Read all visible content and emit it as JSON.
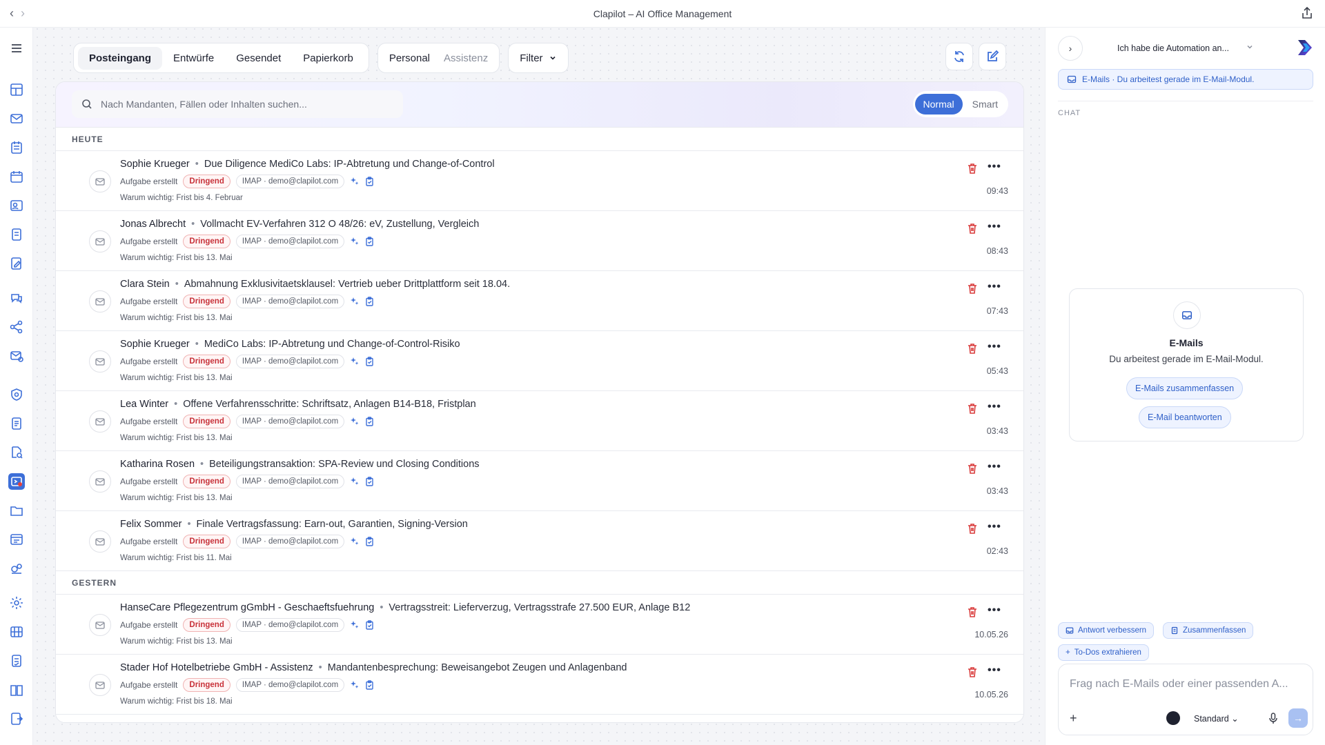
{
  "window": {
    "title": "Clapilot – AI Office Management"
  },
  "toolbar": {
    "tabs": [
      "Posteingang",
      "Entwürfe",
      "Gesendet",
      "Papierkorb"
    ],
    "scope": [
      "Personal",
      "Assistenz"
    ],
    "filter_label": "Filter"
  },
  "search": {
    "placeholder": "Nach Mandanten, Fällen oder Inhalten suchen...",
    "modes": [
      "Normal",
      "Smart"
    ]
  },
  "sections": {
    "today": "HEUTE",
    "yesterday": "GESTERN"
  },
  "labels": {
    "status": "Aufgabe erstellt",
    "urgent": "Dringend",
    "account": "IMAP · demo@clapilot.com"
  },
  "emails": [
    {
      "sender": "Sophie Krueger",
      "subject": "Due Diligence MediCo Labs: IP-Abtretung und Change-of-Control",
      "reason": "Warum wichtig: Frist bis 4. Februar",
      "time": "09:43"
    },
    {
      "sender": "Jonas Albrecht",
      "subject": "Vollmacht EV-Verfahren 312 O 48/26: eV, Zustellung, Vergleich",
      "reason": "Warum wichtig: Frist bis 13. Mai",
      "time": "08:43"
    },
    {
      "sender": "Clara Stein",
      "subject": "Abmahnung Exklusivitaetsklausel: Vertrieb ueber Drittplattform seit 18.04.",
      "reason": "Warum wichtig: Frist bis 13. Mai",
      "time": "07:43"
    },
    {
      "sender": "Sophie Krueger",
      "subject": "MediCo Labs: IP-Abtretung und Change-of-Control-Risiko",
      "reason": "Warum wichtig: Frist bis 13. Mai",
      "time": "05:43"
    },
    {
      "sender": "Lea Winter",
      "subject": "Offene Verfahrensschritte: Schriftsatz, Anlagen B14-B18, Fristplan",
      "reason": "Warum wichtig: Frist bis 13. Mai",
      "time": "03:43"
    },
    {
      "sender": "Katharina Rosen",
      "subject": "Beteiligungstransaktion: SPA-Review und Closing Conditions",
      "reason": "Warum wichtig: Frist bis 13. Mai",
      "time": "03:43"
    },
    {
      "sender": "Felix Sommer",
      "subject": "Finale Vertragsfassung: Earn-out, Garantien, Signing-Version",
      "reason": "Warum wichtig: Frist bis 11. Mai",
      "time": "02:43"
    },
    {
      "sender": "HanseCare Pflegezentrum gGmbH - Geschaeftsfuehrung",
      "subject": "Vertragsstreit: Lieferverzug, Vertragsstrafe 27.500 EUR, Anlage B12",
      "reason": "Warum wichtig: Frist bis 13. Mai",
      "time": "10.05.26"
    },
    {
      "sender": "Stader Hof Hotelbetriebe GmbH - Assistenz",
      "subject": "Mandantenbesprechung: Beweisangebot Zeugen und Anlagenband",
      "reason": "Warum wichtig: Frist bis 18. Mai",
      "time": "10.05.26"
    }
  ],
  "chat": {
    "conversation_title": "Ich habe die Automation an...",
    "context": "E-Mails · Du arbeitest gerade im E-Mail-Modul.",
    "section_label": "CHAT",
    "card": {
      "title": "E-Mails",
      "subtitle": "Du arbeitest gerade im E-Mail-Modul.",
      "actions": [
        "E-Mails zusammenfassen",
        "E-Mail beantworten"
      ]
    },
    "chips": [
      "Antwort verbessern",
      "Zusammenfassen",
      "To-Dos extrahieren"
    ],
    "input_placeholder": "Frag nach E-Mails oder einer passenden A...",
    "model": "Standard"
  },
  "colors": {
    "accent": "#3d6fd8",
    "urgent": "#c8323a",
    "trash": "#d93a3a"
  }
}
